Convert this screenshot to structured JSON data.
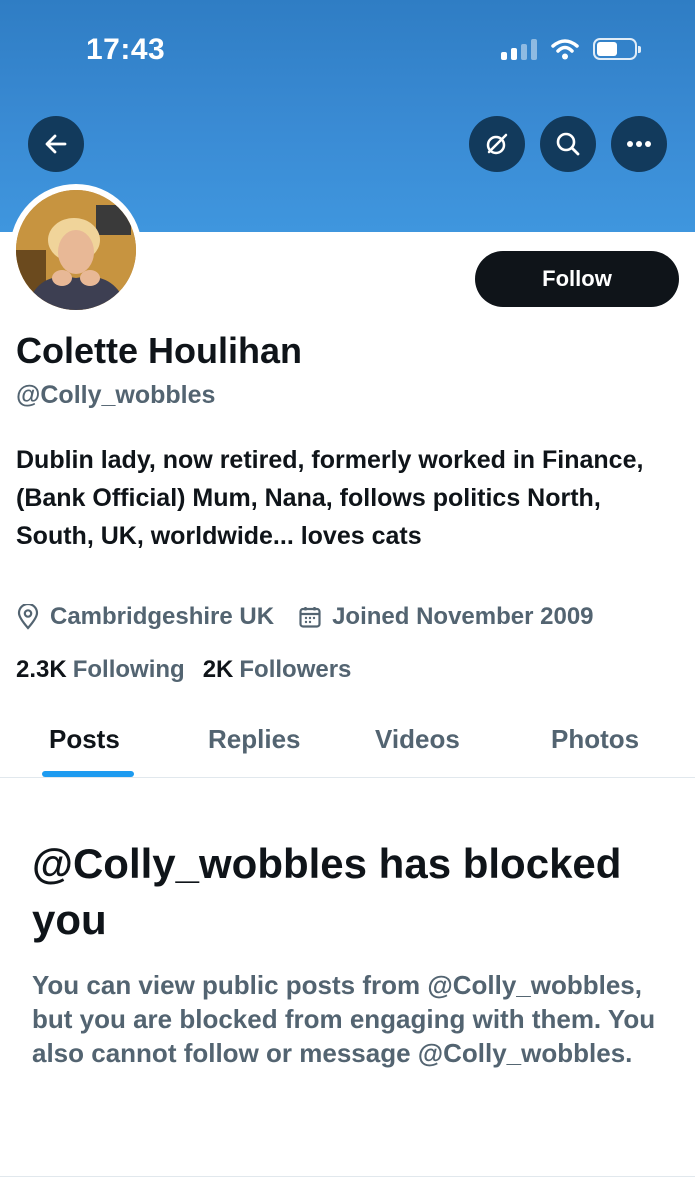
{
  "status_bar": {
    "time": "17:43"
  },
  "profile": {
    "name": "Colette Houlihan",
    "handle": "@Colly_wobbles",
    "bio": "Dublin lady, now retired, formerly worked in Finance, (Bank Official) Mum, Nana, follows politics North, South, UK, worldwide... loves cats",
    "location": "Cambridgeshire UK",
    "joined": "Joined November 2009",
    "following_count": "2.3K",
    "following_label": "Following",
    "followers_count": "2K",
    "followers_label": "Followers"
  },
  "actions": {
    "follow_label": "Follow"
  },
  "tabs": [
    {
      "label": "Posts",
      "active": true
    },
    {
      "label": "Replies",
      "active": false
    },
    {
      "label": "Videos",
      "active": false
    },
    {
      "label": "Photos",
      "active": false
    }
  ],
  "blocked_notice": {
    "title": "@Colly_wobbles has blocked you",
    "description": "You can view public posts from @Colly_wobbles, but you are blocked from engaging with them. You also cannot follow or message @Colly_wobbles."
  },
  "colors": {
    "banner": "#3a8bd4",
    "accent": "#1d9bf0",
    "text_primary": "#0f1419",
    "text_secondary": "#536471",
    "icon_button_bg": "#123a5c"
  },
  "icons": [
    "back-arrow-icon",
    "grok-icon",
    "search-icon",
    "more-icon",
    "location-icon",
    "calendar-icon",
    "wifi-icon",
    "signal-icon",
    "battery-icon"
  ]
}
